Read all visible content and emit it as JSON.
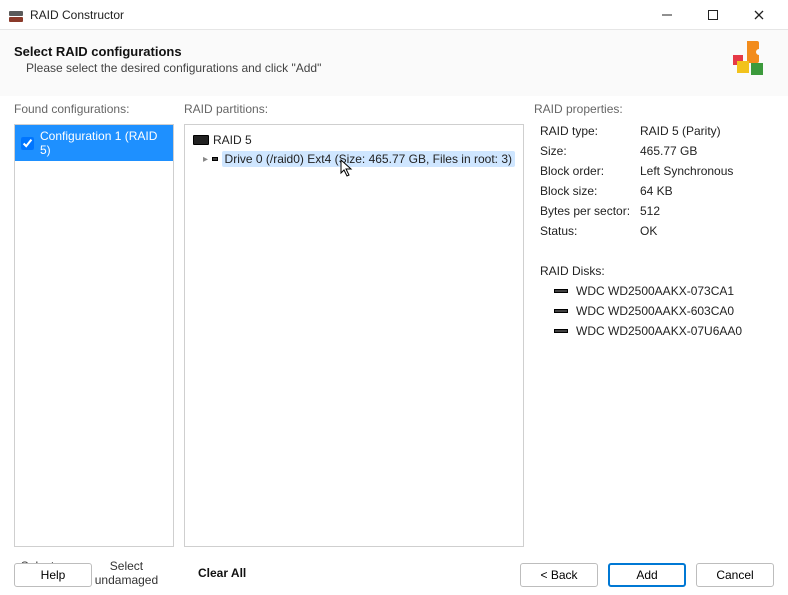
{
  "window": {
    "title": "RAID Constructor"
  },
  "header": {
    "title": "Select RAID configurations",
    "subtitle": "Please select the desired configurations and click \"Add\""
  },
  "labels": {
    "found": "Found configurations:",
    "partitions": "RAID partitions:",
    "properties": "RAID properties:",
    "raid_disks": "RAID Disks:"
  },
  "found_config": {
    "label": "Configuration 1 (RAID 5)",
    "checked": true
  },
  "partitions": {
    "root_label": "RAID 5",
    "child_label": "Drive 0 (/raid0) Ext4 (Size: 465.77 GB, Files in root: 3)"
  },
  "properties": {
    "type_k": "RAID type:",
    "type_v": "RAID 5 (Parity)",
    "size_k": "Size:",
    "size_v": "465.77 GB",
    "block_order_k": "Block order:",
    "block_order_v": "Left Synchronous",
    "block_size_k": "Block size:",
    "block_size_v": "64 KB",
    "bps_k": "Bytes per sector:",
    "bps_v": "512",
    "status_k": "Status:",
    "status_v": "OK"
  },
  "disks": {
    "d0": "WDC WD2500AAKX-073CA1",
    "d1": "WDC WD2500AAKX-603CA0",
    "d2": "WDC WD2500AAKX-07U6AA0"
  },
  "actions": {
    "select_all": "Select All",
    "select_undamaged": "Select undamaged",
    "clear_all": "Clear All"
  },
  "buttons": {
    "help": "Help",
    "back": "< Back",
    "add": "Add",
    "cancel": "Cancel"
  }
}
